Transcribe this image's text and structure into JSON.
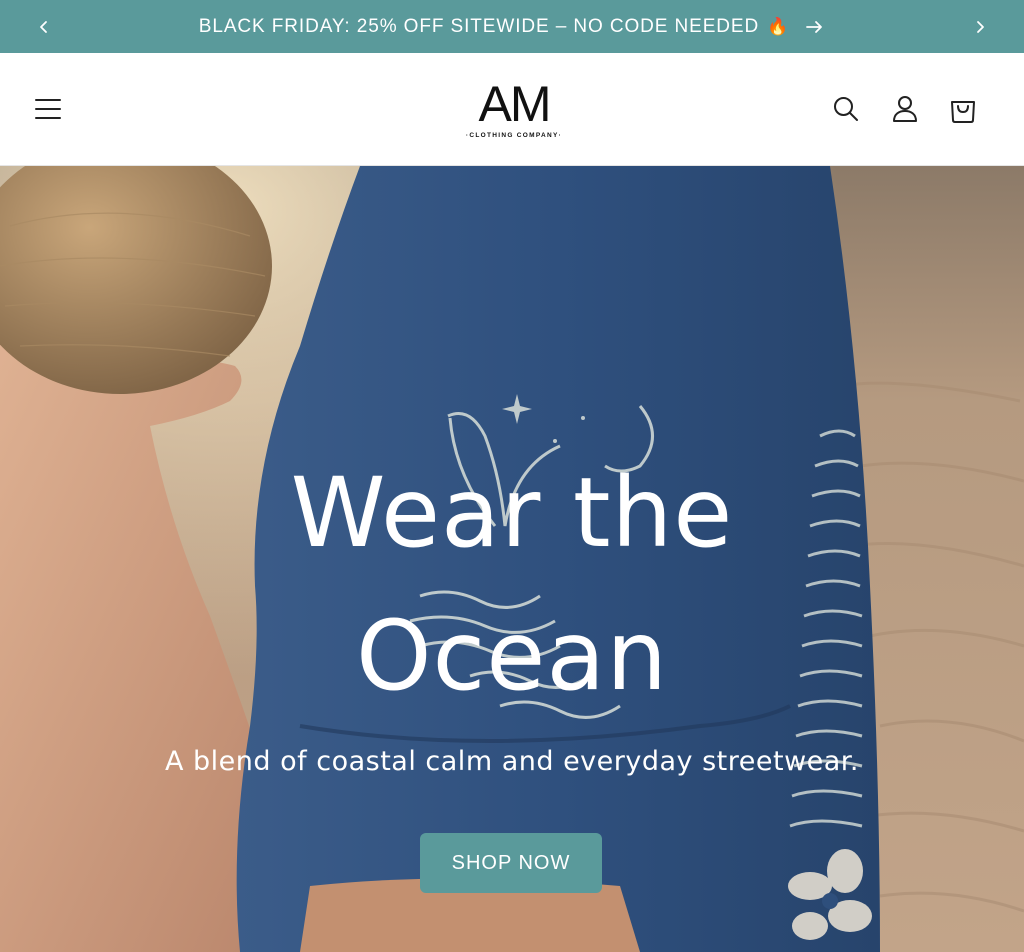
{
  "announcement": {
    "text": "BLACK FRIDAY: 25% OFF SITEWIDE – NO CODE NEEDED",
    "emoji": "🔥",
    "prev_icon": "chevron-left-icon",
    "next_icon": "chevron-right-icon",
    "link_icon": "arrow-right-icon"
  },
  "header": {
    "logo_mark": "AM",
    "logo_sub": "·CLOTHING COMPANY·",
    "menu_icon": "hamburger-icon",
    "search_icon": "search-icon",
    "account_icon": "account-icon",
    "cart_icon": "cart-icon"
  },
  "hero": {
    "headline_line1": "Wear the",
    "headline_line2": "Ocean",
    "tagline": "A blend of coastal calm and everyday streetwear.",
    "cta_label": "SHOP NOW"
  },
  "colors": {
    "brand_teal": "#5a9a9b",
    "header_bg": "#ffffff",
    "text_dark": "#111111",
    "shirt_blue": "#2f4f7c",
    "sand": "#b99a7d"
  }
}
